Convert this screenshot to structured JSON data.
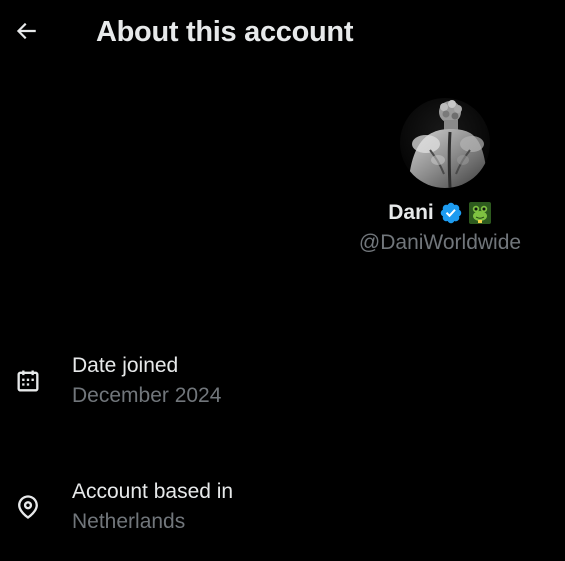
{
  "header": {
    "back_icon": "arrow-left-icon",
    "title": "About this account"
  },
  "profile": {
    "avatar_icon": "profile-photo",
    "display_name": "Dani",
    "verified_icon": "verified-badge-icon",
    "verified_color": "#1d9bf0",
    "affiliation_icon": "green-frog-icon",
    "handle": "@DaniWorldwide"
  },
  "details": [
    {
      "icon": "calendar-icon",
      "label": "Date joined",
      "value": "December 2024"
    },
    {
      "icon": "location-pin-icon",
      "label": "Account based in",
      "value": "Netherlands"
    }
  ],
  "colors": {
    "background": "#000000",
    "primary_text": "#e7e9ea",
    "secondary_text": "#71767b"
  }
}
